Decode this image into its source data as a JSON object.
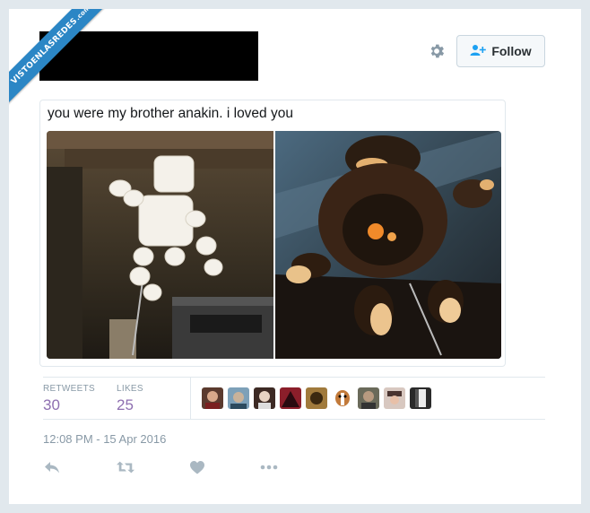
{
  "watermark": {
    "text": "VISTOENLASREDES",
    "suffix": ".com"
  },
  "header": {
    "follow_label": "Follow"
  },
  "tweet": {
    "text": "you were my brother anakin. i loved you",
    "timestamp": "12:08 PM - 15 Apr 2016"
  },
  "stats": {
    "retweets_label": "RETWEETS",
    "retweets": "30",
    "likes_label": "LIKES",
    "likes": "25"
  },
  "icons": {
    "settings": "gear-icon",
    "follow": "add-user-icon",
    "reply": "reply-icon",
    "retweet": "retweet-icon",
    "like": "heart-icon",
    "more": "more-icon"
  },
  "colors": {
    "accent_count": "#8e6fb0",
    "muted": "#8899a6",
    "ribbon": "#2b86c5"
  },
  "liker_avatar_count": 9
}
